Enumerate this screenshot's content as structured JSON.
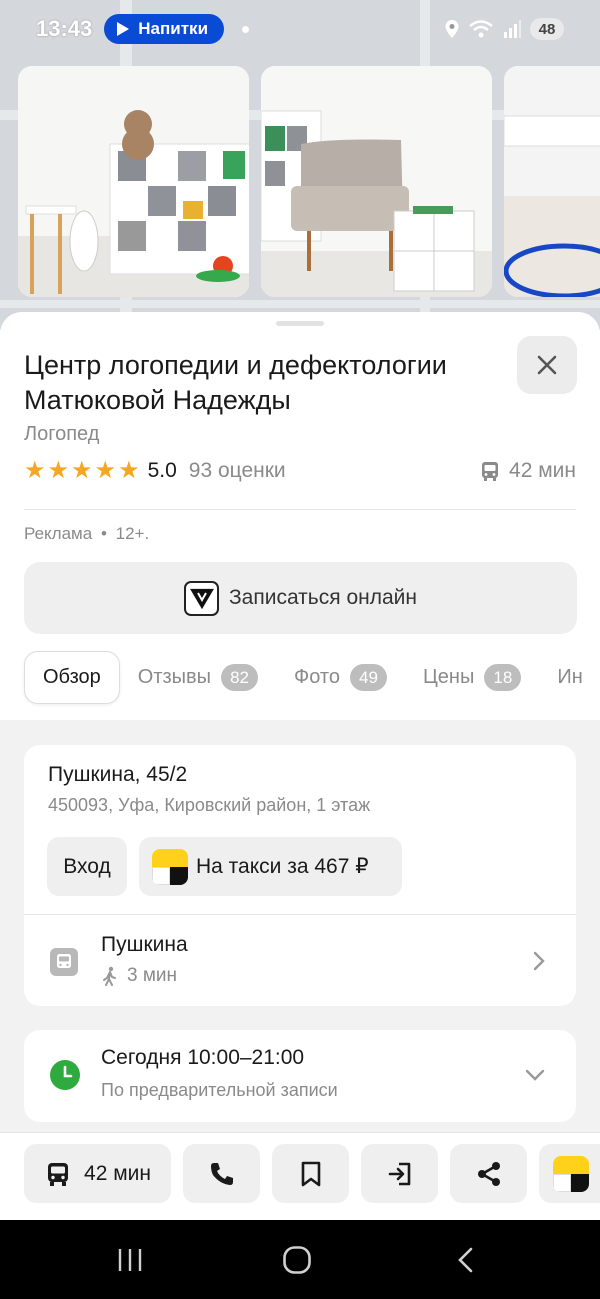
{
  "status_bar": {
    "time": "13:43",
    "media_label": "Напитки",
    "battery": "48"
  },
  "photos": [
    {
      "icon": "toy-bear-shelf-photo"
    },
    {
      "icon": "armchair-photo"
    },
    {
      "icon": "gym-hoop-photo"
    }
  ],
  "place": {
    "title": "Центр логопедии и дефектологии Матюковой Надежды",
    "category": "Логопед",
    "rating_value": "5.0",
    "rating_count": "93 оценки",
    "stars": 5,
    "transit_time": "42 мин"
  },
  "ad": {
    "label": "Реклама",
    "age": "12+."
  },
  "booking": {
    "label": "Записаться онлайн"
  },
  "tabs": [
    {
      "label": "Обзор",
      "badge": ""
    },
    {
      "label": "Отзывы",
      "badge": "82"
    },
    {
      "label": "Фото",
      "badge": "49"
    },
    {
      "label": "Цены",
      "badge": "18"
    },
    {
      "label": "Ин",
      "badge": ""
    }
  ],
  "address": {
    "main": "Пушкина, 45/2",
    "sub": "450093, Уфа, Кировский район, 1 этаж",
    "entrance_label": "Вход",
    "taxi_label": "На такси за 467 ₽"
  },
  "stop": {
    "name": "Пушкина",
    "walk_time": "3 мин"
  },
  "hours": {
    "main": "Сегодня 10:00–21:00",
    "sub": "По предварительной записи"
  },
  "actions": {
    "route_time": "42 мин"
  },
  "colors": {
    "star": "#f5a623",
    "open_green": "#2eaa3e",
    "taxi_yellow": "#ffd11a",
    "media_pill": "#0a4bd6"
  }
}
